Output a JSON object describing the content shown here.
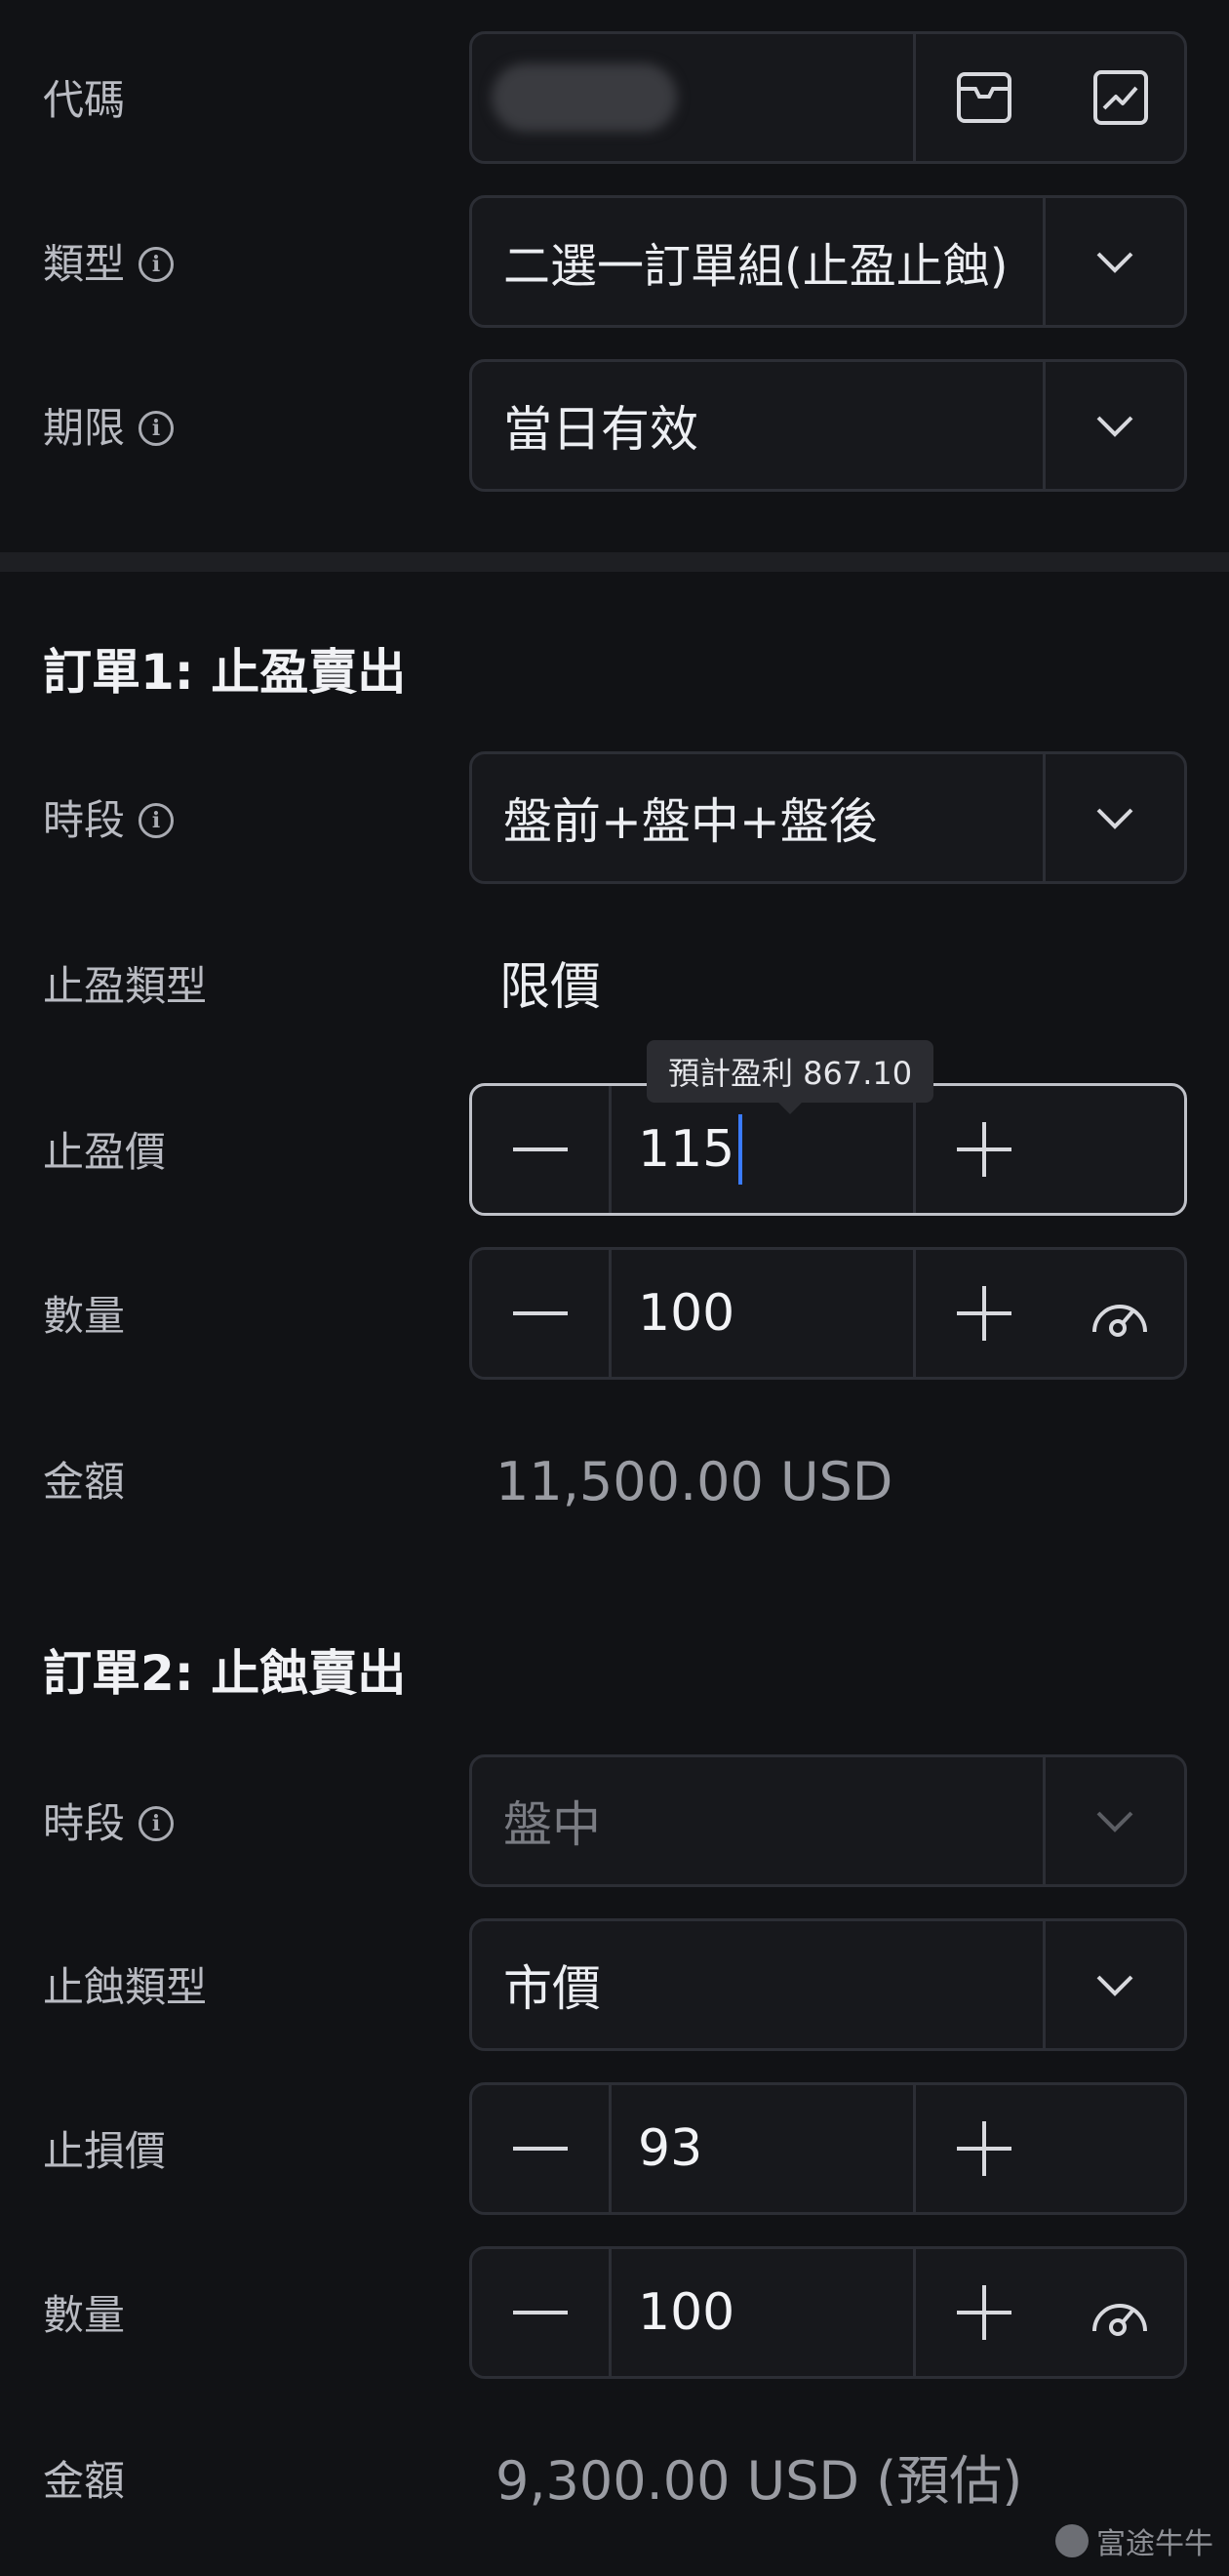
{
  "header": {
    "code": {
      "label": "代碼"
    },
    "type": {
      "label": "類型",
      "value": "二選一訂單組(止盈止蝕)"
    },
    "duration": {
      "label": "期限",
      "value": "當日有效"
    }
  },
  "order1": {
    "title": "訂單1: 止盈賣出",
    "session": {
      "label": "時段",
      "value": "盤前+盤中+盤後"
    },
    "tp_type": {
      "label": "止盈類型",
      "value": "限價"
    },
    "tp_price": {
      "label": "止盈價",
      "value": "115",
      "tooltip": "預計盈利 867.10"
    },
    "quantity": {
      "label": "數量",
      "value": "100"
    },
    "amount": {
      "label": "金額",
      "value": "11,500.00 USD"
    }
  },
  "order2": {
    "title": "訂單2: 止蝕賣出",
    "session": {
      "label": "時段",
      "value": "盤中"
    },
    "sl_type": {
      "label": "止蝕類型",
      "value": "市價"
    },
    "sl_price": {
      "label": "止損價",
      "value": "93"
    },
    "quantity": {
      "label": "數量",
      "value": "100"
    },
    "amount": {
      "label": "金額",
      "value": "9,300.00 USD (預估)"
    }
  },
  "watermark": "富途牛牛",
  "icons": {
    "info": "info-icon",
    "chevron": "chevron-down-icon",
    "minus": "minus-icon",
    "plus": "plus-icon",
    "gauge": "gauge-icon",
    "box": "position-box-icon",
    "chart": "chart-icon"
  },
  "colors": {
    "background": "#111215",
    "caret": "#3a7bff",
    "border": "#2c2e35"
  }
}
